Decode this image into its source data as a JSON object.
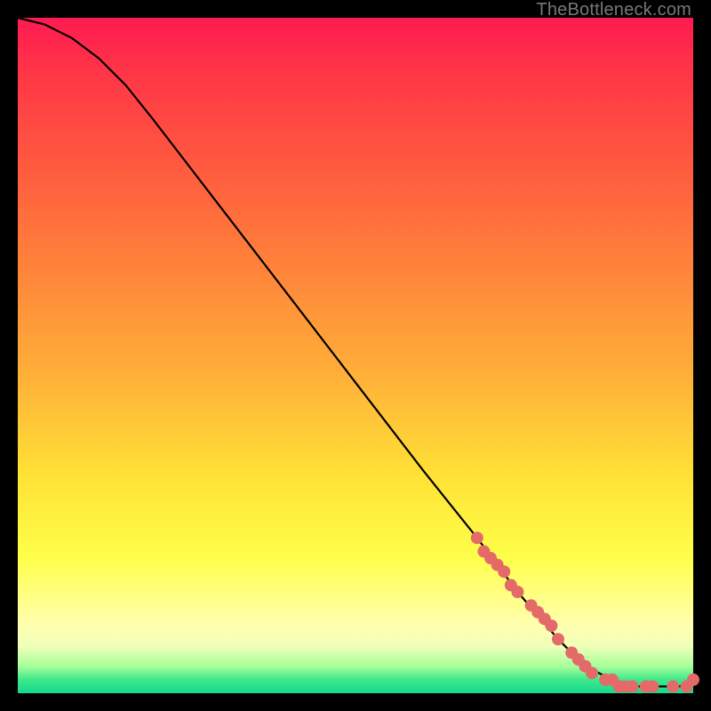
{
  "watermark": "TheBottleneck.com",
  "chart_data": {
    "type": "line",
    "title": "",
    "xlabel": "",
    "ylabel": "",
    "xlim": [
      0,
      100
    ],
    "ylim": [
      0,
      100
    ],
    "grid": false,
    "series": [
      {
        "name": "curve",
        "color": "#000000",
        "x": [
          0,
          4,
          8,
          12,
          16,
          20,
          30,
          40,
          50,
          60,
          68,
          74,
          80,
          84,
          88,
          90,
          92,
          94,
          96,
          98,
          100
        ],
        "y": [
          100,
          99,
          97,
          94,
          90,
          85,
          72,
          59,
          46,
          33,
          23,
          15,
          8,
          4,
          2,
          1,
          1,
          1,
          1,
          1,
          2
        ]
      }
    ],
    "points": {
      "name": "markers",
      "color": "#e46a6a",
      "radius_px": 7,
      "x": [
        68,
        69,
        70,
        71,
        72,
        73,
        74,
        76,
        77,
        78,
        79,
        80,
        82,
        83,
        84,
        85,
        87,
        88,
        89,
        90,
        91,
        93,
        94,
        97,
        99,
        100
      ],
      "y": [
        23,
        21,
        20,
        19,
        18,
        16,
        15,
        13,
        12,
        11,
        10,
        8,
        6,
        5,
        4,
        3,
        2,
        2,
        1,
        1,
        1,
        1,
        1,
        1,
        1,
        2
      ]
    }
  }
}
